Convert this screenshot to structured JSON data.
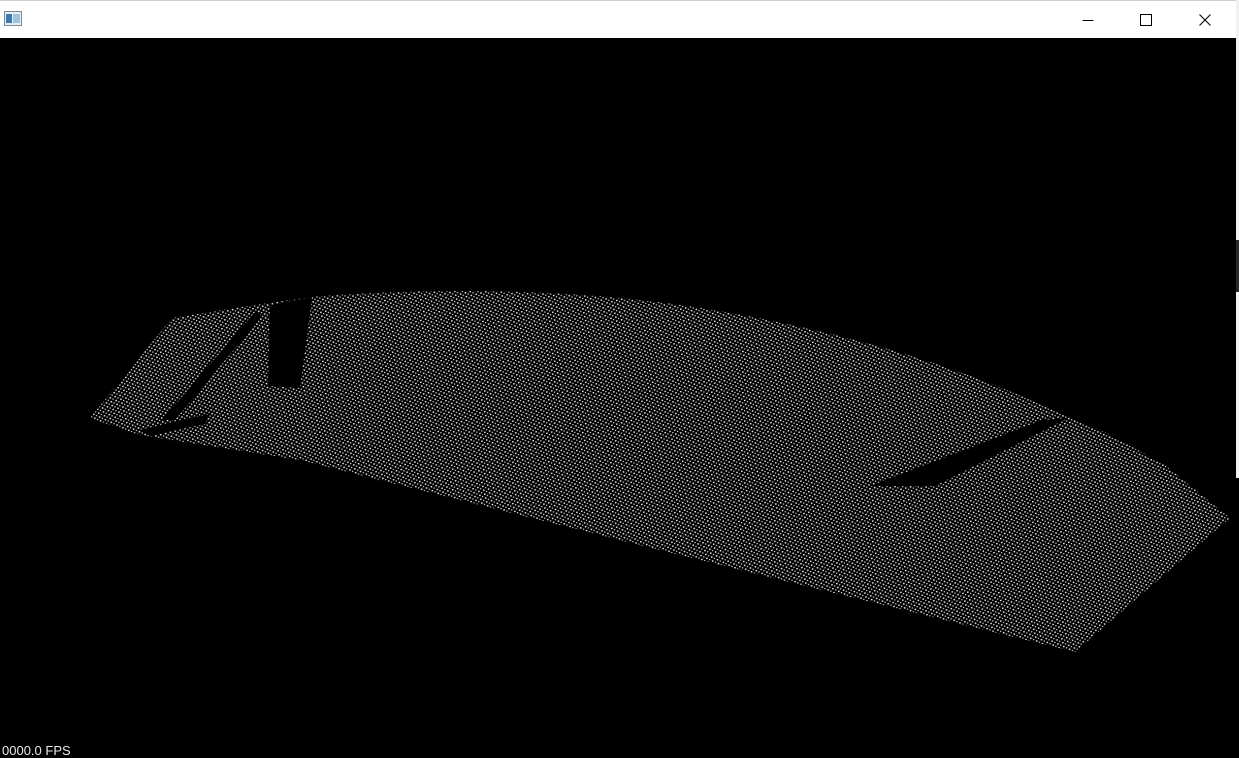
{
  "window": {
    "title": "",
    "background": "#000000",
    "titlebar_background": "#ffffff"
  },
  "titlebar": {
    "icon": "app-window-icon",
    "buttons": [
      {
        "name": "minimize-button",
        "icon": "minimize-icon"
      },
      {
        "name": "maximize-button",
        "icon": "maximize-icon"
      },
      {
        "name": "close-button",
        "icon": "close-icon"
      }
    ]
  },
  "viewport": {
    "content": "point-cloud",
    "point_color": "#ffffff",
    "fps_label": "0000.0 FPS"
  }
}
